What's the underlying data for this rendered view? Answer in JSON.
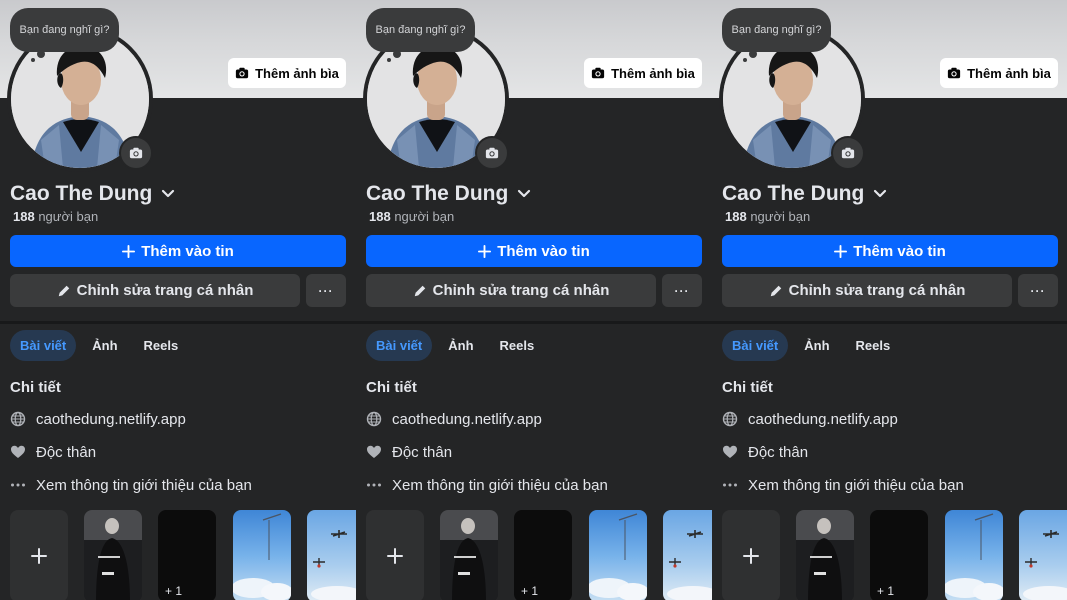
{
  "profile": {
    "note_prompt": "Bạn đang nghĩ gì?",
    "add_cover_label": "Thêm ảnh bìa",
    "name": "Cao The Dung",
    "friends_count": "188",
    "friends_label": "người bạn",
    "add_story_label": "Thêm vào tin",
    "edit_profile_label": "Chỉnh sửa trang cá nhân",
    "more_label": "···"
  },
  "tabs": [
    {
      "label": "Bài viết",
      "active": true
    },
    {
      "label": "Ảnh",
      "active": false
    },
    {
      "label": "Reels",
      "active": false
    }
  ],
  "details": {
    "title": "Chi tiết",
    "items": [
      {
        "icon": "globe-icon",
        "text": "caothedung.netlify.app"
      },
      {
        "icon": "heart-icon",
        "text": "Độc thân"
      },
      {
        "icon": "more-dots-icon",
        "text": "Xem thông tin giới thiệu của bạn"
      }
    ]
  },
  "thumbnails": {
    "add_label": "+",
    "extra_count_label": "+ 1"
  },
  "colors": {
    "background": "#242526",
    "primary_button": "#0866ff",
    "secondary_button": "#3a3b3c",
    "active_tab_bg": "#263951",
    "active_tab_text": "#4599ff"
  }
}
